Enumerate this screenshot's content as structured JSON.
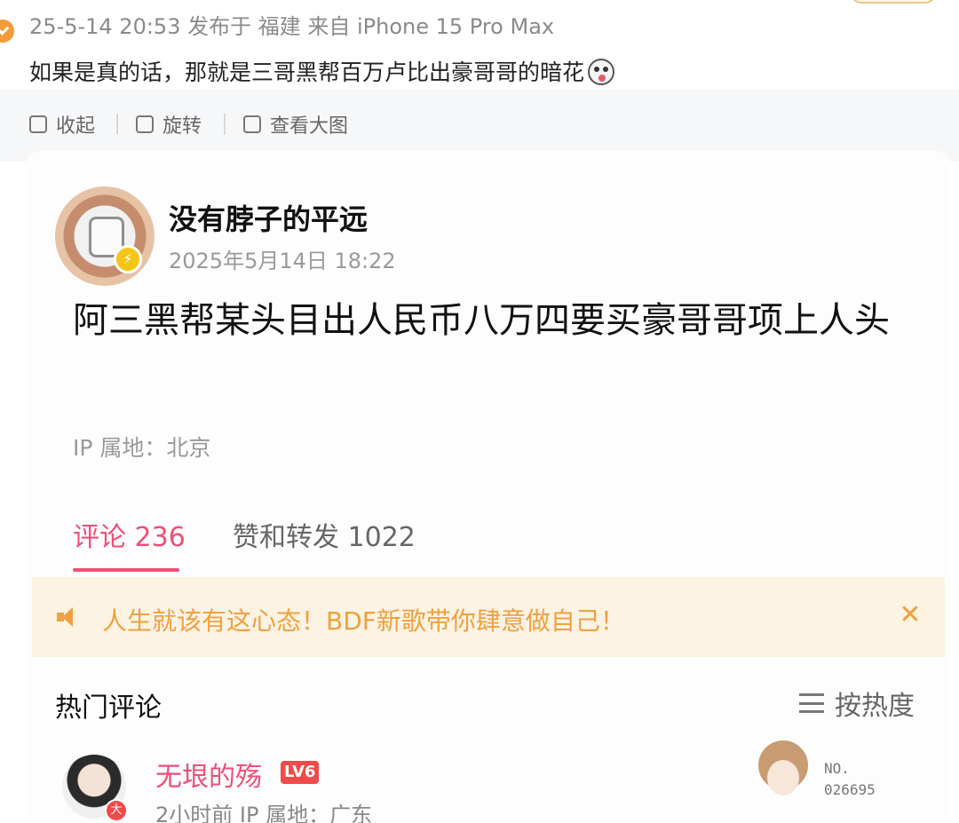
{
  "outer_post": {
    "meta": "25-5-14 20:53 发布于 福建 来自 iPhone 15 Pro Max",
    "text": "如果是真的话，那就是三哥黑帮百万卢比出豪哥哥的暗花",
    "tools": [
      "收起",
      "旋转",
      "查看大图"
    ]
  },
  "embedded_post": {
    "author": "没有脖子的平远",
    "time": "2025年5月14日 18:22",
    "body": "阿三黑帮某头目出人民币八万四要买豪哥哥项上人头",
    "ip_location": "IP 属地：北京",
    "tabs": {
      "comments": "评论 236",
      "likes_reposts": "赞和转发 1022"
    },
    "notice": "人生就该有这心态！BDF新歌带你肆意做自己！",
    "hot_comments_title": "热门评论",
    "sort_label": "按热度",
    "comment": {
      "name": "无垠的殇",
      "level": "LV6",
      "meta": "2小时前 IP 属地：广东",
      "fan_no_label": "NO.",
      "fan_no_value": "026695"
    }
  },
  "colors": {
    "accent_pink": "#ef4f76",
    "notice_orange": "#f0a040",
    "notice_bg": "#fdf3e3",
    "level_red": "#f04a4a",
    "verified_yellow": "#f5c518"
  },
  "icons": [
    "check-badge-icon",
    "collapse-icon",
    "rotate-icon",
    "view-image-icon",
    "verified-icon",
    "speaker-icon",
    "close-icon",
    "sort-icon",
    "emoji-face-icon"
  ]
}
